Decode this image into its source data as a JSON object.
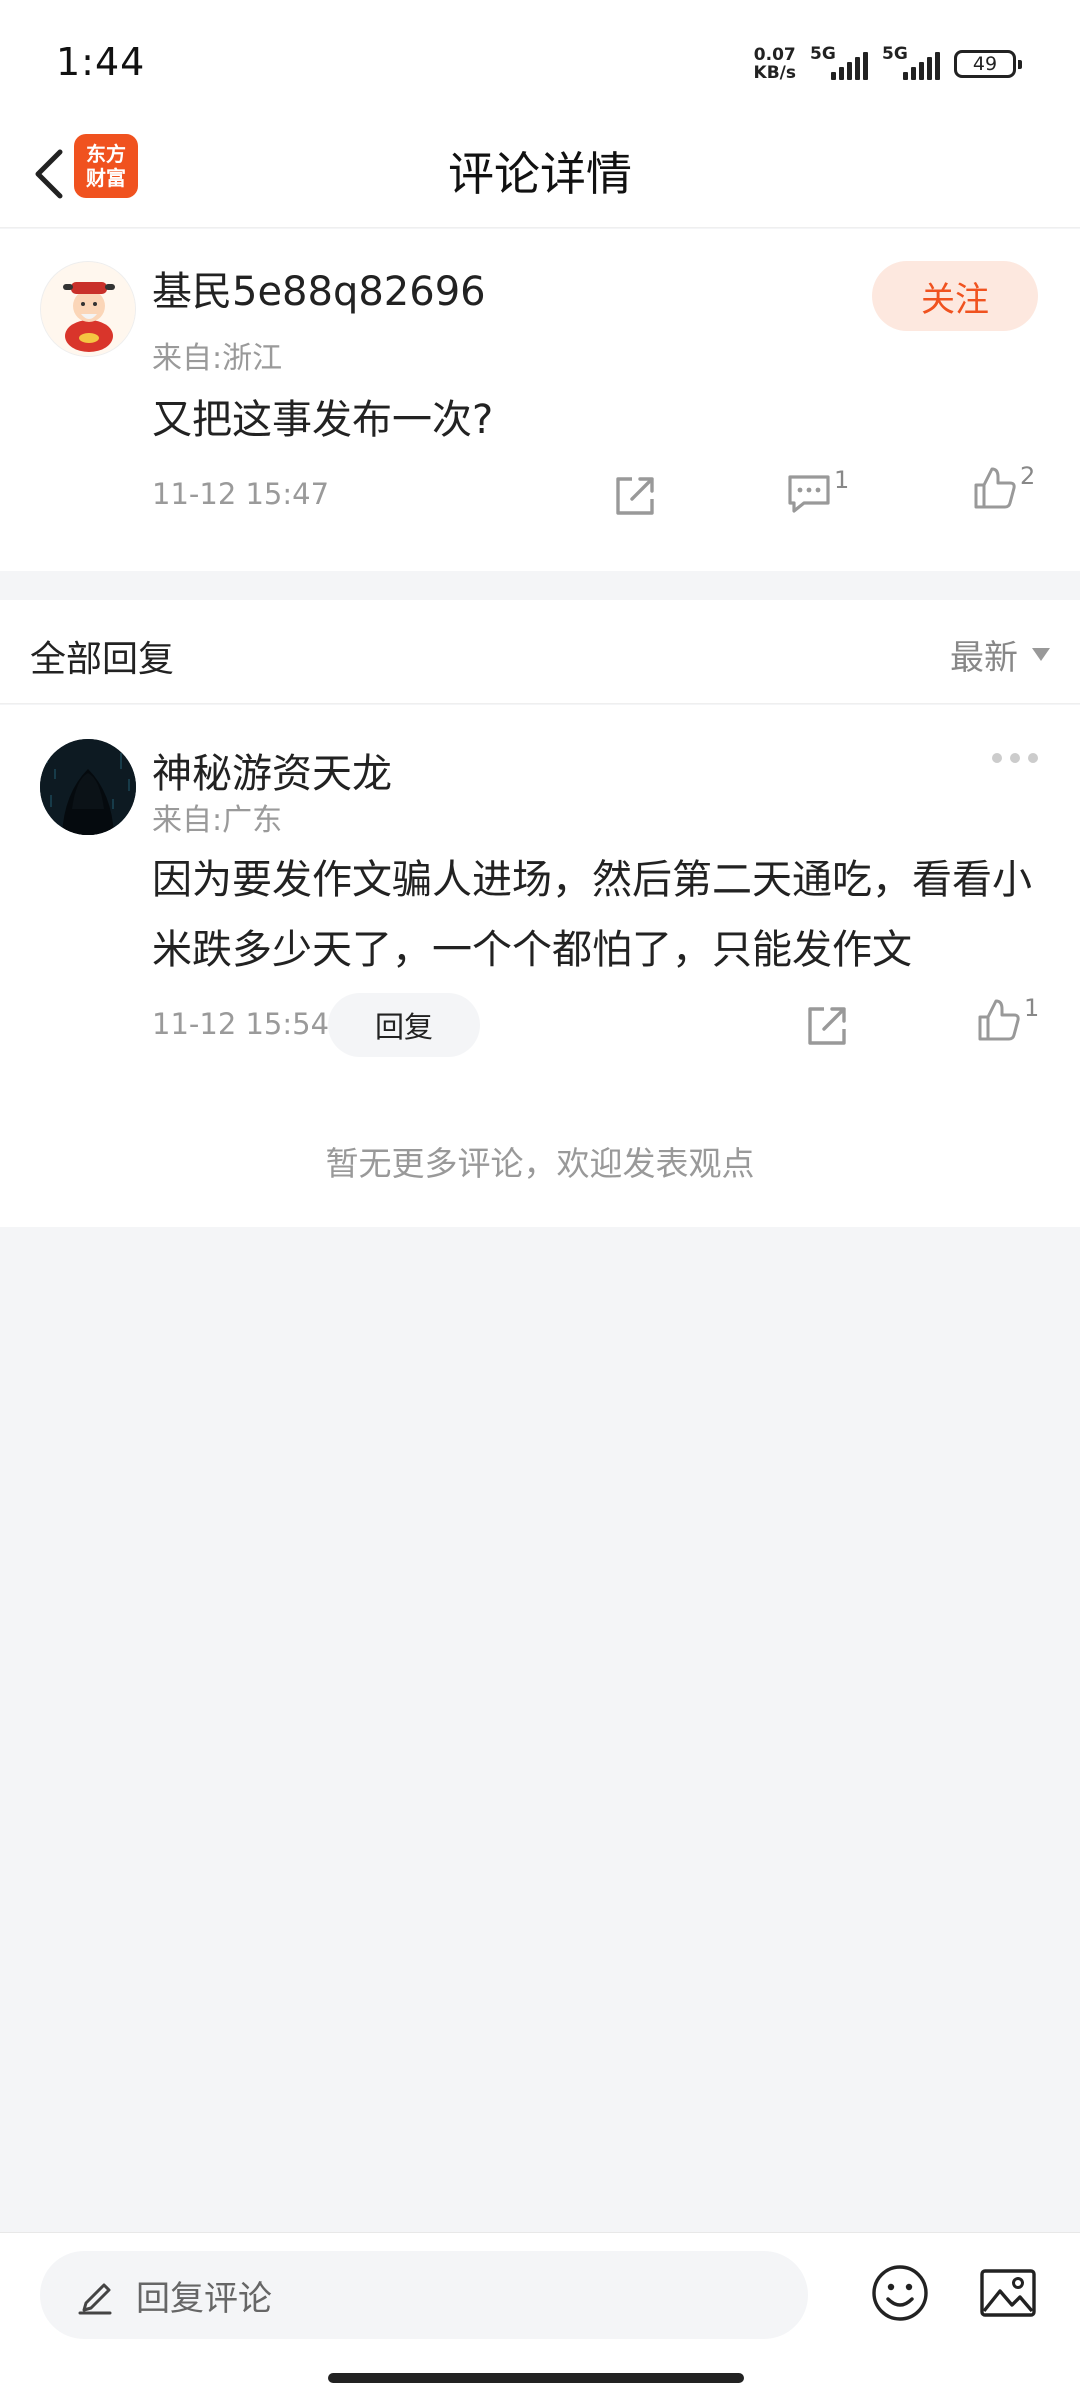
{
  "status_bar": {
    "time": "1:44",
    "net_speed_value": "0.07",
    "net_speed_unit": "KB/s",
    "signal1_label": "5G",
    "signal2_label": "5G",
    "battery": "49"
  },
  "header": {
    "title": "评论详情",
    "logo_line1": "东方",
    "logo_line2": "财富",
    "icons": {
      "back": "chevron-left-icon"
    }
  },
  "main_comment": {
    "username": "基民5e88q82696",
    "location": "来自:浙江",
    "text": "又把这事发布一次?",
    "timestamp": "11-12 15:47",
    "follow_label": "关注",
    "reply_count": "1",
    "like_count": "2"
  },
  "replies_section": {
    "title": "全部回复",
    "sort_label": "最新"
  },
  "replies": [
    {
      "username": "神秘游资天龙",
      "location": "来自:广东",
      "text": "因为要发作文骗人进场，然后第二天通吃，看看小米跌多少天了，一个个都怕了，只能发作文",
      "timestamp": "11-12 15:54",
      "reply_label": "回复",
      "like_count": "1"
    }
  ],
  "no_more_text": "暂无更多评论，欢迎发表观点",
  "bottom_bar": {
    "input_placeholder": "回复评论"
  },
  "colors": {
    "brand": "#f0521f",
    "follow_bg": "#fde8df",
    "page_bg": "#f4f5f7"
  }
}
